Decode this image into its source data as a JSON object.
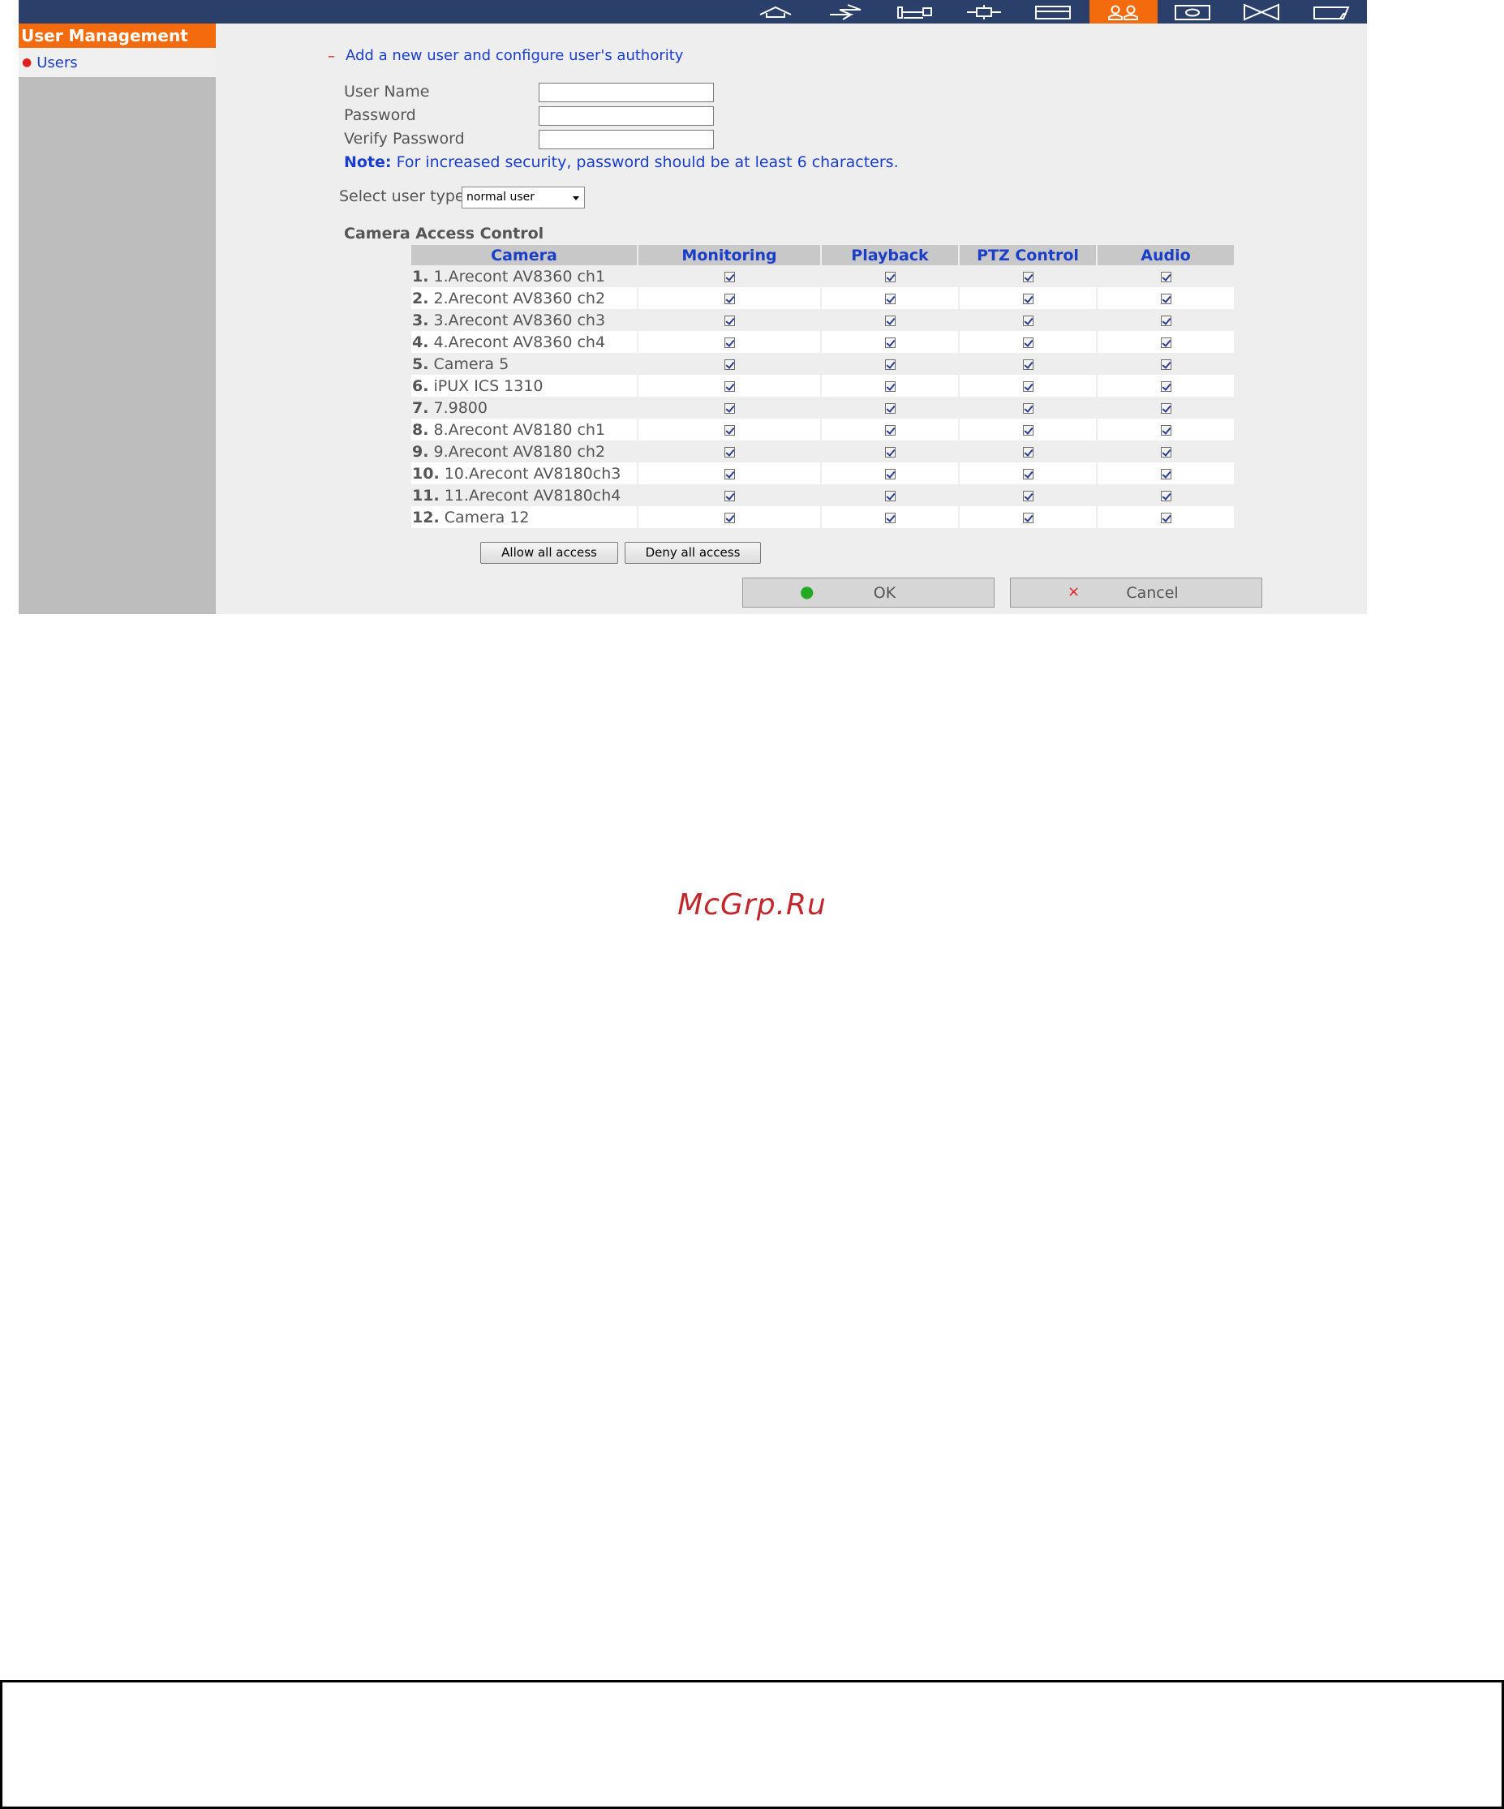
{
  "nav": {
    "icons": [
      {
        "name": "home-icon",
        "active": false
      },
      {
        "name": "network-icon",
        "active": false
      },
      {
        "name": "device-config-icon",
        "active": false
      },
      {
        "name": "camera-settings-icon",
        "active": false
      },
      {
        "name": "storage-icon",
        "active": false
      },
      {
        "name": "users-icon",
        "active": true
      },
      {
        "name": "monitor-icon",
        "active": false
      },
      {
        "name": "event-icon",
        "active": false
      },
      {
        "name": "log-icon",
        "active": false
      }
    ],
    "accent_color": "#f36b0c",
    "bar_color": "#2b3f6b"
  },
  "sidebar": {
    "header": "User Management",
    "items": [
      {
        "label": "Users"
      }
    ]
  },
  "main": {
    "title": "Add a new user and configure user's authority",
    "form": {
      "username_label": "User Name",
      "password_label": "Password",
      "verify_label": "Verify Password",
      "username_value": "",
      "password_value": "",
      "verify_value": ""
    },
    "note_label": "Note:",
    "note_text": " For increased security, password should be at least 6 characters.",
    "user_type_label": "Select user type:",
    "user_type_value": "normal user",
    "access_title": "Camera Access Control",
    "columns": [
      "Camera",
      "Monitoring",
      "Playback",
      "PTZ Control",
      "Audio"
    ],
    "cameras": [
      {
        "num": "1.",
        "name": "1.Arecont AV8360 ch1",
        "monitoring": true,
        "playback": true,
        "ptz": true,
        "audio": true
      },
      {
        "num": "2.",
        "name": "2.Arecont AV8360 ch2",
        "monitoring": true,
        "playback": true,
        "ptz": true,
        "audio": true
      },
      {
        "num": "3.",
        "name": "3.Arecont AV8360 ch3",
        "monitoring": true,
        "playback": true,
        "ptz": true,
        "audio": true
      },
      {
        "num": "4.",
        "name": "4.Arecont AV8360 ch4",
        "monitoring": true,
        "playback": true,
        "ptz": true,
        "audio": true
      },
      {
        "num": "5.",
        "name": "Camera 5",
        "monitoring": true,
        "playback": true,
        "ptz": true,
        "audio": true
      },
      {
        "num": "6.",
        "name": "iPUX ICS 1310",
        "monitoring": true,
        "playback": true,
        "ptz": true,
        "audio": true
      },
      {
        "num": "7.",
        "name": "7.9800",
        "monitoring": true,
        "playback": true,
        "ptz": true,
        "audio": true
      },
      {
        "num": "8.",
        "name": "8.Arecont AV8180 ch1",
        "monitoring": true,
        "playback": true,
        "ptz": true,
        "audio": true
      },
      {
        "num": "9.",
        "name": "9.Arecont AV8180 ch2",
        "monitoring": true,
        "playback": true,
        "ptz": true,
        "audio": true
      },
      {
        "num": "10.",
        "name": "10.Arecont AV8180ch3",
        "monitoring": true,
        "playback": true,
        "ptz": true,
        "audio": true
      },
      {
        "num": "11.",
        "name": "11.Arecont AV8180ch4",
        "monitoring": true,
        "playback": true,
        "ptz": true,
        "audio": true
      },
      {
        "num": "12.",
        "name": "Camera 12",
        "monitoring": true,
        "playback": true,
        "ptz": true,
        "audio": true
      }
    ],
    "allow_label": "Allow all access",
    "deny_label": "Deny all access",
    "ok_label": "OK",
    "cancel_label": "Cancel",
    "ok_icon": "●",
    "cancel_icon": "×"
  },
  "watermark": "McGrp.Ru"
}
